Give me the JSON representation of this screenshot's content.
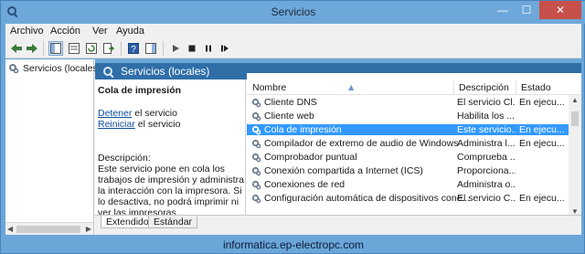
{
  "window": {
    "title": "Servicios",
    "minimize_glyph": "—",
    "maximize_glyph": "☐",
    "close_glyph": "✕"
  },
  "menu": [
    "Archivo",
    "Acción",
    "Ver",
    "Ayuda"
  ],
  "toolbar": {
    "icons": [
      "back-icon",
      "forward-icon",
      "console-tree-icon",
      "properties-icon",
      "refresh-icon",
      "export-list-icon",
      "help-icon",
      "show-hide-icon",
      "play-icon",
      "stop-icon",
      "pause-icon",
      "restart-icon"
    ]
  },
  "tree": {
    "root_label": "Servicios (locales)"
  },
  "pane_header": {
    "title": "Servicios (locales)"
  },
  "detail": {
    "service_name": "Cola de impresión",
    "stop_link": "Detener",
    "stop_suffix": " el servicio",
    "restart_link": "Reiniciar",
    "restart_suffix": " el servicio",
    "description_label": "Descripción:",
    "description_text": "Este servicio pone en cola los trabajos de impresión y administra la interacción con la impresora. Si lo desactiva, no podrá imprimir ni ver las impresoras."
  },
  "list": {
    "columns": [
      "Nombre",
      "Descripción",
      "Estado"
    ],
    "rows": [
      {
        "name": "Cliente DNS",
        "description": "El servicio Cl...",
        "status": "En ejecu...",
        "selected": false
      },
      {
        "name": "Cliente web",
        "description": "Habilita los ...",
        "status": "",
        "selected": false
      },
      {
        "name": "Cola de impresión",
        "description": "Este servicio...",
        "status": "En ejecu...",
        "selected": true
      },
      {
        "name": "Compilador de extremo de audio de Windows",
        "description": "Administra l...",
        "status": "En ejecu...",
        "selected": false
      },
      {
        "name": "Comprobador puntual",
        "description": "Comprueba ...",
        "status": "",
        "selected": false
      },
      {
        "name": "Conexión compartida a Internet (ICS)",
        "description": "Proporciona...",
        "status": "",
        "selected": false
      },
      {
        "name": "Conexiones de red",
        "description": "Administra o...",
        "status": "",
        "selected": false
      },
      {
        "name": "Configuración automática de dispositivos cone...",
        "description": "El servicio C...",
        "status": "En ejecu...",
        "selected": false
      }
    ]
  },
  "tabs": [
    "Extendido",
    "Estándar"
  ],
  "footer": {
    "text": "informatica.ep-electropc.com"
  },
  "colors": {
    "selection": "#3399ff",
    "header_bar": "#2f6ea7",
    "window_frame": "#6aa6d8",
    "link": "#0c4d9e"
  }
}
